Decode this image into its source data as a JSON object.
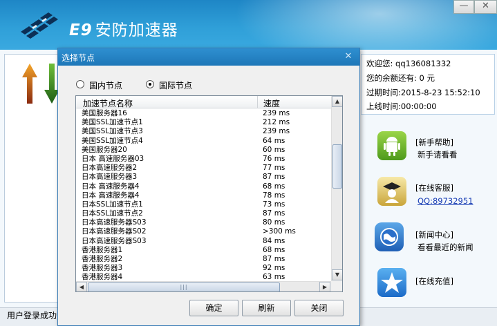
{
  "app": {
    "title": "安防加速器",
    "brand_mark": "E9"
  },
  "window_controls": {
    "minimize": "—",
    "close": "✕"
  },
  "status": {
    "text": "用户登录成功"
  },
  "user": {
    "welcome_label": "欢迎您:",
    "username": "qq136081332",
    "balance_line": "您的余额还有: 0 元",
    "expire_line": "过期时间:2015-8-23 15:52:10",
    "online_line": "上线时间:00:00:00"
  },
  "services": [
    {
      "title": "[新手帮助]",
      "sub": "新手请看看",
      "icon": "android-icon"
    },
    {
      "title": "[在线客服]",
      "sub": "QQ:89732951",
      "icon": "graduate-icon"
    },
    {
      "title": "[新闻中心]",
      "sub": "看看最近的新闻",
      "icon": "globe-icon"
    },
    {
      "title": "[在线充值]",
      "sub": "",
      "icon": "star-icon"
    }
  ],
  "dialog": {
    "title": "选择节点",
    "close": "✕",
    "radio_domestic": "国内节点",
    "radio_international": "国际节点",
    "selected_radio": "international",
    "col_name": "加速节点名称",
    "col_speed": "速度",
    "nodes": [
      {
        "name": "美国服务器16",
        "speed": "239 ms"
      },
      {
        "name": "美国SSL加速节点1",
        "speed": "212 ms"
      },
      {
        "name": "美国SSL加速节点3",
        "speed": "239 ms"
      },
      {
        "name": "美国SSL加速节点4",
        "speed": "64 ms"
      },
      {
        "name": "美国服务器20",
        "speed": "60 ms"
      },
      {
        "name": "日本 高速服务器03",
        "speed": "76 ms"
      },
      {
        "name": "日本高速服务器2",
        "speed": "77 ms"
      },
      {
        "name": "日本高速服务器3",
        "speed": "87 ms"
      },
      {
        "name": "日本 高速服务器4",
        "speed": "68 ms"
      },
      {
        "name": "日本 高速服务器4",
        "speed": "78 ms"
      },
      {
        "name": "日本SSL加速节点1",
        "speed": "73 ms"
      },
      {
        "name": "日本SSL加速节点2",
        "speed": "87 ms"
      },
      {
        "name": "日本高速服务器S03",
        "speed": "80 ms"
      },
      {
        "name": "日本高速服务器S02",
        "speed": ">300 ms"
      },
      {
        "name": "日本高速服务器S03",
        "speed": "84 ms"
      },
      {
        "name": "香港服务器1",
        "speed": "68 ms"
      },
      {
        "name": "香港服务器2",
        "speed": "87 ms"
      },
      {
        "name": "香港服务器3",
        "speed": "92 ms"
      },
      {
        "name": "香港服务器4",
        "speed": "63 ms"
      }
    ],
    "btn_ok": "确定",
    "btn_refresh": "刷新",
    "btn_close": "关闭"
  },
  "colors": {
    "title_blue": "#2f9fd8",
    "dialog_blue": "#1e77b8",
    "link": "#1a3fb5"
  }
}
